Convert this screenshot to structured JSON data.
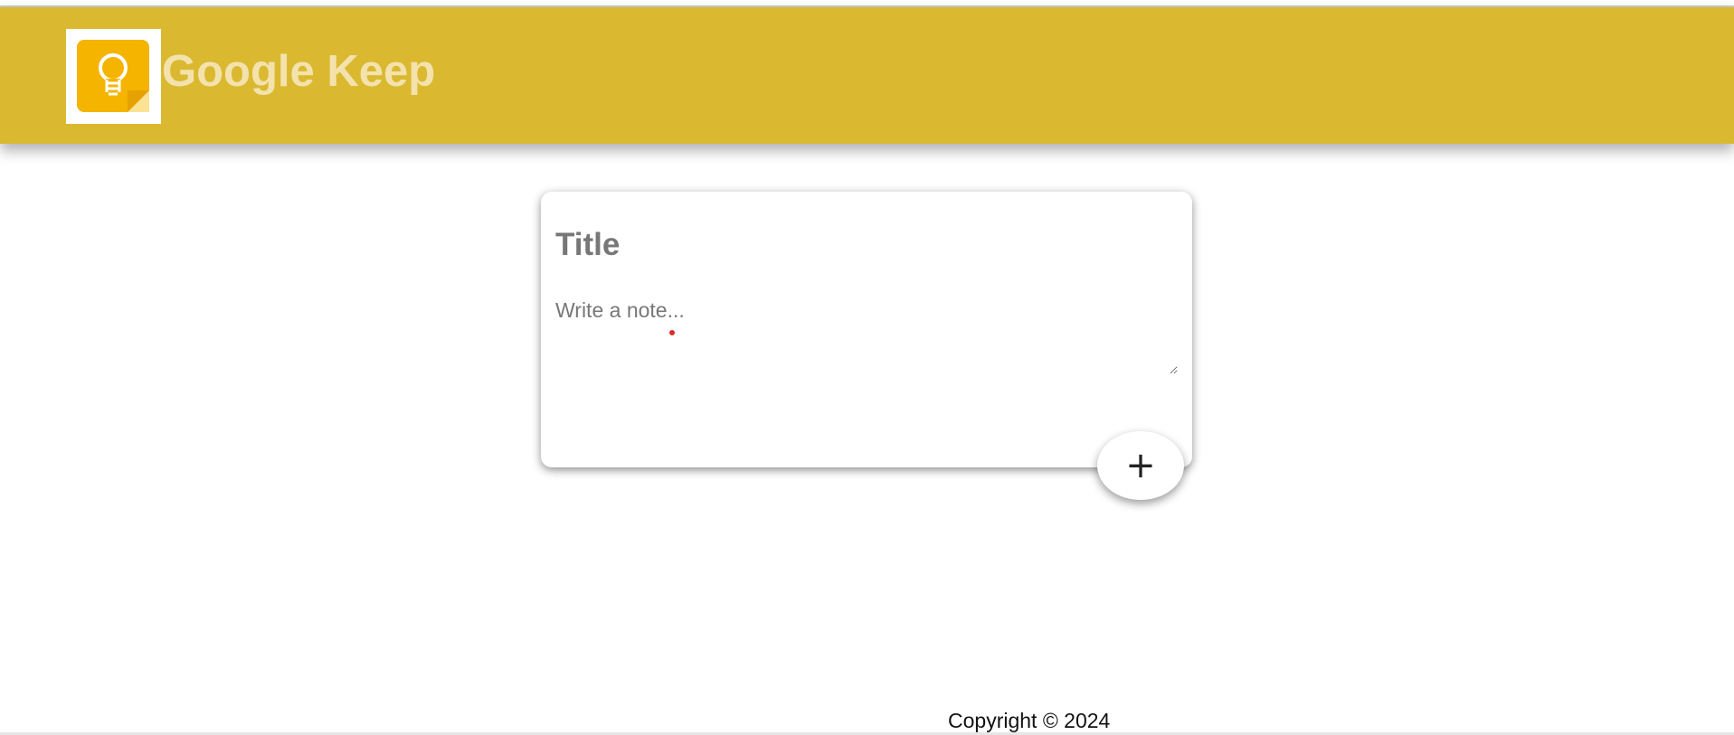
{
  "header": {
    "title": "Google Keep",
    "logo_icon": "google-keep-lightbulb-icon",
    "background_color": "#dab931",
    "title_color": "#f4e2ad"
  },
  "note_form": {
    "title_placeholder": "Title",
    "note_placeholder": "Write a note...",
    "add_button_label": "+",
    "add_button_icon": "plus-icon"
  },
  "footer": {
    "copyright_text": "Copyright © 2024"
  }
}
